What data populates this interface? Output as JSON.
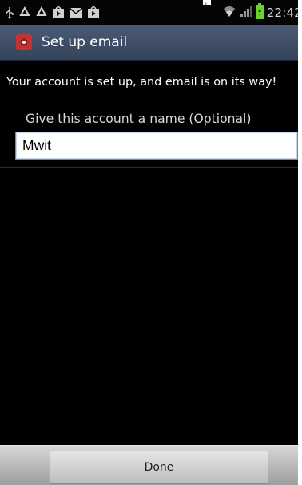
{
  "status_bar": {
    "time": "22:42",
    "left_icons": [
      "usb-icon",
      "recycle-icon",
      "recycle-icon",
      "play-store-icon",
      "gmail-icon",
      "play-store-icon"
    ],
    "right_icons": [
      "wifi-icon",
      "signal-icon",
      "battery-icon"
    ],
    "top_overlay_char": "ู"
  },
  "title_bar": {
    "title": "Set up email",
    "icon": "email-app-icon"
  },
  "content": {
    "message": "Your account is set up, and email is on its way!",
    "account_name_label": "Give this account a name (Optional)",
    "account_name_value": "Mwit"
  },
  "bottom_bar": {
    "done_label": "Done"
  },
  "colors": {
    "background": "#000000",
    "title_bar": "#3f4d66",
    "bottom_bar": "#bdbdbd",
    "battery": "#6fd12c"
  }
}
